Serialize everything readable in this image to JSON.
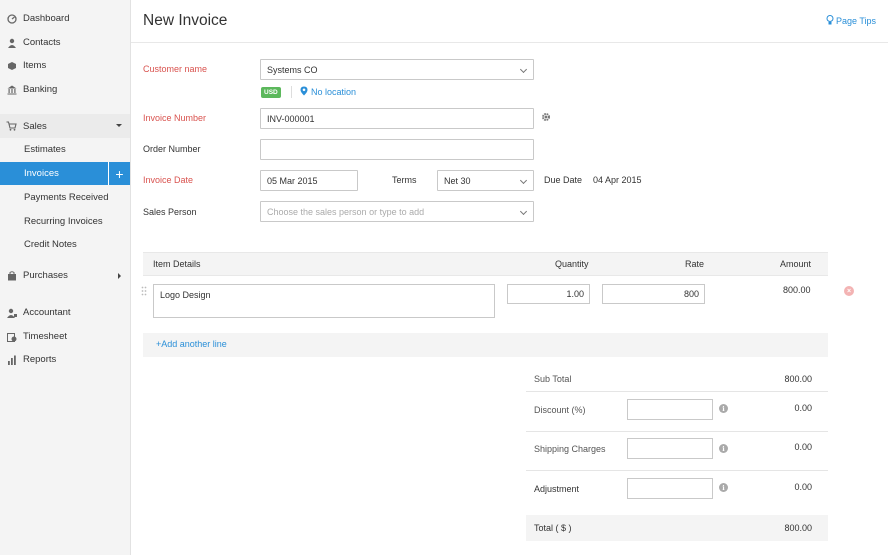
{
  "sidebar": {
    "items": [
      {
        "label": "Dashboard",
        "icon": "dashboard-icon"
      },
      {
        "label": "Contacts",
        "icon": "contacts-icon"
      },
      {
        "label": "Items",
        "icon": "items-icon"
      },
      {
        "label": "Banking",
        "icon": "banking-icon"
      }
    ],
    "sales": {
      "label": "Sales",
      "subitems": [
        "Estimates",
        "Invoices",
        "Payments Received",
        "Recurring Invoices",
        "Credit Notes"
      ],
      "active": "Invoices"
    },
    "purchases": {
      "label": "Purchases"
    },
    "bottom_items": [
      {
        "label": "Accountant"
      },
      {
        "label": "Timesheet"
      },
      {
        "label": "Reports"
      }
    ]
  },
  "header": {
    "title": "New Invoice",
    "page_tips": "Page Tips"
  },
  "form": {
    "customer_name_label": "Customer name",
    "customer_name_value": "Systems CO",
    "currency_badge": "USD",
    "location_link": "No location",
    "invoice_number_label": "Invoice Number",
    "invoice_number_value": "INV-000001",
    "order_number_label": "Order Number",
    "order_number_value": "",
    "invoice_date_label": "Invoice Date",
    "invoice_date_value": "05 Mar 2015",
    "terms_label": "Terms",
    "terms_value": "Net 30",
    "due_date_label": "Due Date",
    "due_date_value": "04 Apr 2015",
    "sales_person_label": "Sales Person",
    "sales_person_placeholder": "Choose the sales person or type to add"
  },
  "items_table": {
    "headers": {
      "item": "Item Details",
      "quantity": "Quantity",
      "rate": "Rate",
      "amount": "Amount"
    },
    "rows": [
      {
        "item": "Logo Design",
        "quantity": "1.00",
        "rate": "800",
        "amount": "800.00"
      }
    ],
    "add_line": "Add another line"
  },
  "totals": {
    "sub_total_label": "Sub Total",
    "sub_total_value": "800.00",
    "discount_label": "Discount (%)",
    "discount_value": "0.00",
    "shipping_label": "Shipping Charges",
    "shipping_value": "0.00",
    "adjustment_label": "Adjustment",
    "adjustment_value": "0.00",
    "total_label": "Total ( $ )",
    "total_value": "800.00"
  },
  "colors": {
    "accent": "#2a8fd8",
    "required": "#d9534f",
    "badge": "#5cb85c"
  }
}
